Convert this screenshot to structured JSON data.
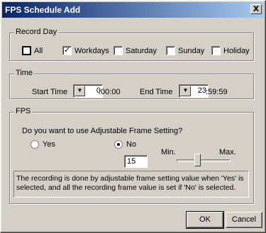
{
  "window": {
    "title": "FPS Schedule Add",
    "close_symbol": "X"
  },
  "record_day": {
    "label": "Record Day",
    "items": [
      {
        "label": "All",
        "checked": false
      },
      {
        "label": "Workdays",
        "checked": true
      },
      {
        "label": "Saturday",
        "checked": false
      },
      {
        "label": "Sunday",
        "checked": false
      },
      {
        "label": "Holiday",
        "checked": false
      }
    ]
  },
  "time": {
    "label": "Time",
    "start_label": "Start Time",
    "start_hour": "0",
    "start_rest": ":00:00",
    "end_label": "End Time",
    "end_hour": "23",
    "end_rest": ":59:59",
    "spin_symbol": "▼"
  },
  "fps": {
    "label": "FPS",
    "question": "Do you want to use Adjustable Frame Setting?",
    "yes_label": "Yes",
    "no_label": "No",
    "selected": "No",
    "frame_value": "15",
    "slider_min": "Min.",
    "slider_max": "Max.",
    "info": "The recording is done by adjustable frame setting value when 'Yes' is selected, and all the recording frame value is set if 'No' is selected."
  },
  "buttons": {
    "ok": "OK",
    "cancel": "Cancel"
  }
}
